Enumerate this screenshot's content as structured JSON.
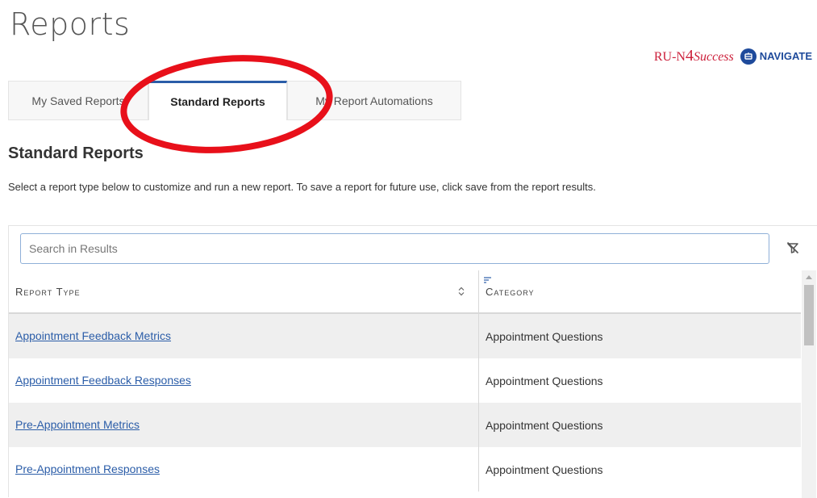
{
  "page": {
    "title": "Reports"
  },
  "brand": {
    "ru_prefix": "RU-N",
    "ru_four": "4",
    "ru_suffix": "Success",
    "navigate": "NAVIGATE"
  },
  "tabs": [
    {
      "label": "My Saved Reports"
    },
    {
      "label": "Standard Reports"
    },
    {
      "label": "My Report Automations"
    }
  ],
  "active_tab": "Standard Reports",
  "section": {
    "title": "Standard Reports",
    "description": "Select a report type below to customize and run a new report. To save a report for future use, click save from the report results."
  },
  "search": {
    "placeholder": "Search in Results",
    "value": ""
  },
  "table": {
    "columns": [
      "Report Type",
      "Category"
    ],
    "rows": [
      {
        "report_type": "Appointment Feedback Metrics",
        "category": "Appointment Questions"
      },
      {
        "report_type": "Appointment Feedback Responses",
        "category": "Appointment Questions"
      },
      {
        "report_type": "Pre-Appointment Metrics",
        "category": "Appointment Questions"
      },
      {
        "report_type": "Pre-Appointment Responses",
        "category": "Appointment Questions"
      }
    ]
  },
  "colors": {
    "accent": "#2b5da8",
    "annotation": "#e8101a",
    "brand_red": "#cc1f3a",
    "brand_blue": "#1e4a9b"
  },
  "icons": [
    "sort-icon",
    "sort-lines-icon",
    "filter-off-icon",
    "navigate-logo-icon"
  ]
}
